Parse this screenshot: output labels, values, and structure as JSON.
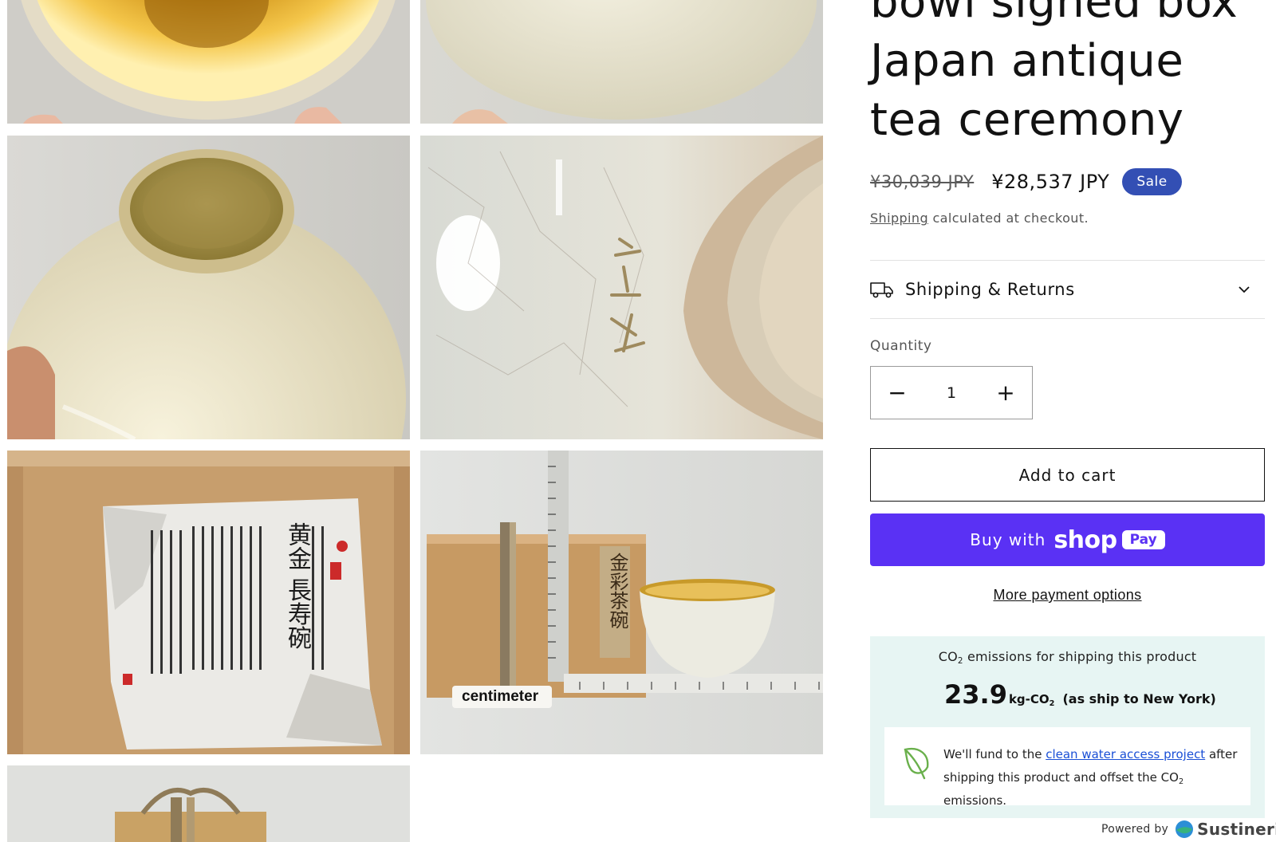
{
  "product": {
    "title": "bowl signed box Japan antique tea ceremony",
    "price_regular": "¥30,039 JPY",
    "price_sale": "¥28,537 JPY",
    "sale_badge": "Sale",
    "shipping_link": "Shipping",
    "shipping_note": " calculated at checkout."
  },
  "gallery": {
    "centimeter_label": "centimeter",
    "paper_title": "黄金 長寿碗",
    "box_label": "金彩茶碗"
  },
  "accordion": {
    "shipping_returns": "Shipping & Returns",
    "icon": "truck-icon"
  },
  "quantity": {
    "label": "Quantity",
    "value": "1",
    "minus": "−",
    "plus": "+"
  },
  "buttons": {
    "add_to_cart": "Add to cart",
    "buy_with": "Buy with",
    "shop": "shop",
    "pay": "Pay",
    "more_payment_options": "More payment options"
  },
  "co2": {
    "heading_pre": "CO",
    "heading_sub": "2",
    "heading_post": " emissions for shipping this product",
    "value": "23.9",
    "unit_pre": "kg-CO",
    "unit_sub": "2",
    "destination": "(as ship to New York)",
    "fund_pre": "We'll fund to the ",
    "fund_link": "clean water access project",
    "fund_mid": " after shipping this product and offset the CO",
    "fund_sub": "2",
    "fund_post": " emissions.",
    "powered_by": "Powered by",
    "brand": "Sustineri",
    "accent": "#e7f5f3"
  },
  "colors": {
    "sale_badge": "#334fb4",
    "shop_pay": "#5a31f4"
  }
}
